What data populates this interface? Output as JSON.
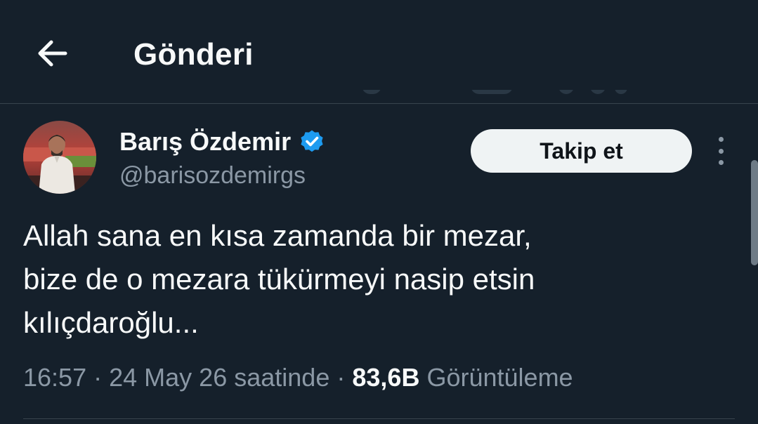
{
  "header": {
    "title": "Gönderi",
    "back_icon": "arrow-left-icon"
  },
  "tweet": {
    "author": {
      "display_name": "Barış Özdemir",
      "handle": "@barisozdemirgs",
      "verified": true,
      "verified_color": "#1d9bf0"
    },
    "follow_label": "Takip et",
    "text": "Allah sana en kısa zamanda bir mezar,\nbize de o mezara tükürmeyi nasip etsin\nkılıçdaroğlu...",
    "time": "16:57",
    "date": "24 May 26 saatinde",
    "views_count": "83,6B",
    "views_label": "Görüntüleme",
    "separator": "·"
  },
  "colors": {
    "background": "#15202b",
    "text_primary": "#f7f9f9",
    "text_secondary": "#8b98a5",
    "divider": "#38444d",
    "button_bg": "#eff3f4"
  }
}
